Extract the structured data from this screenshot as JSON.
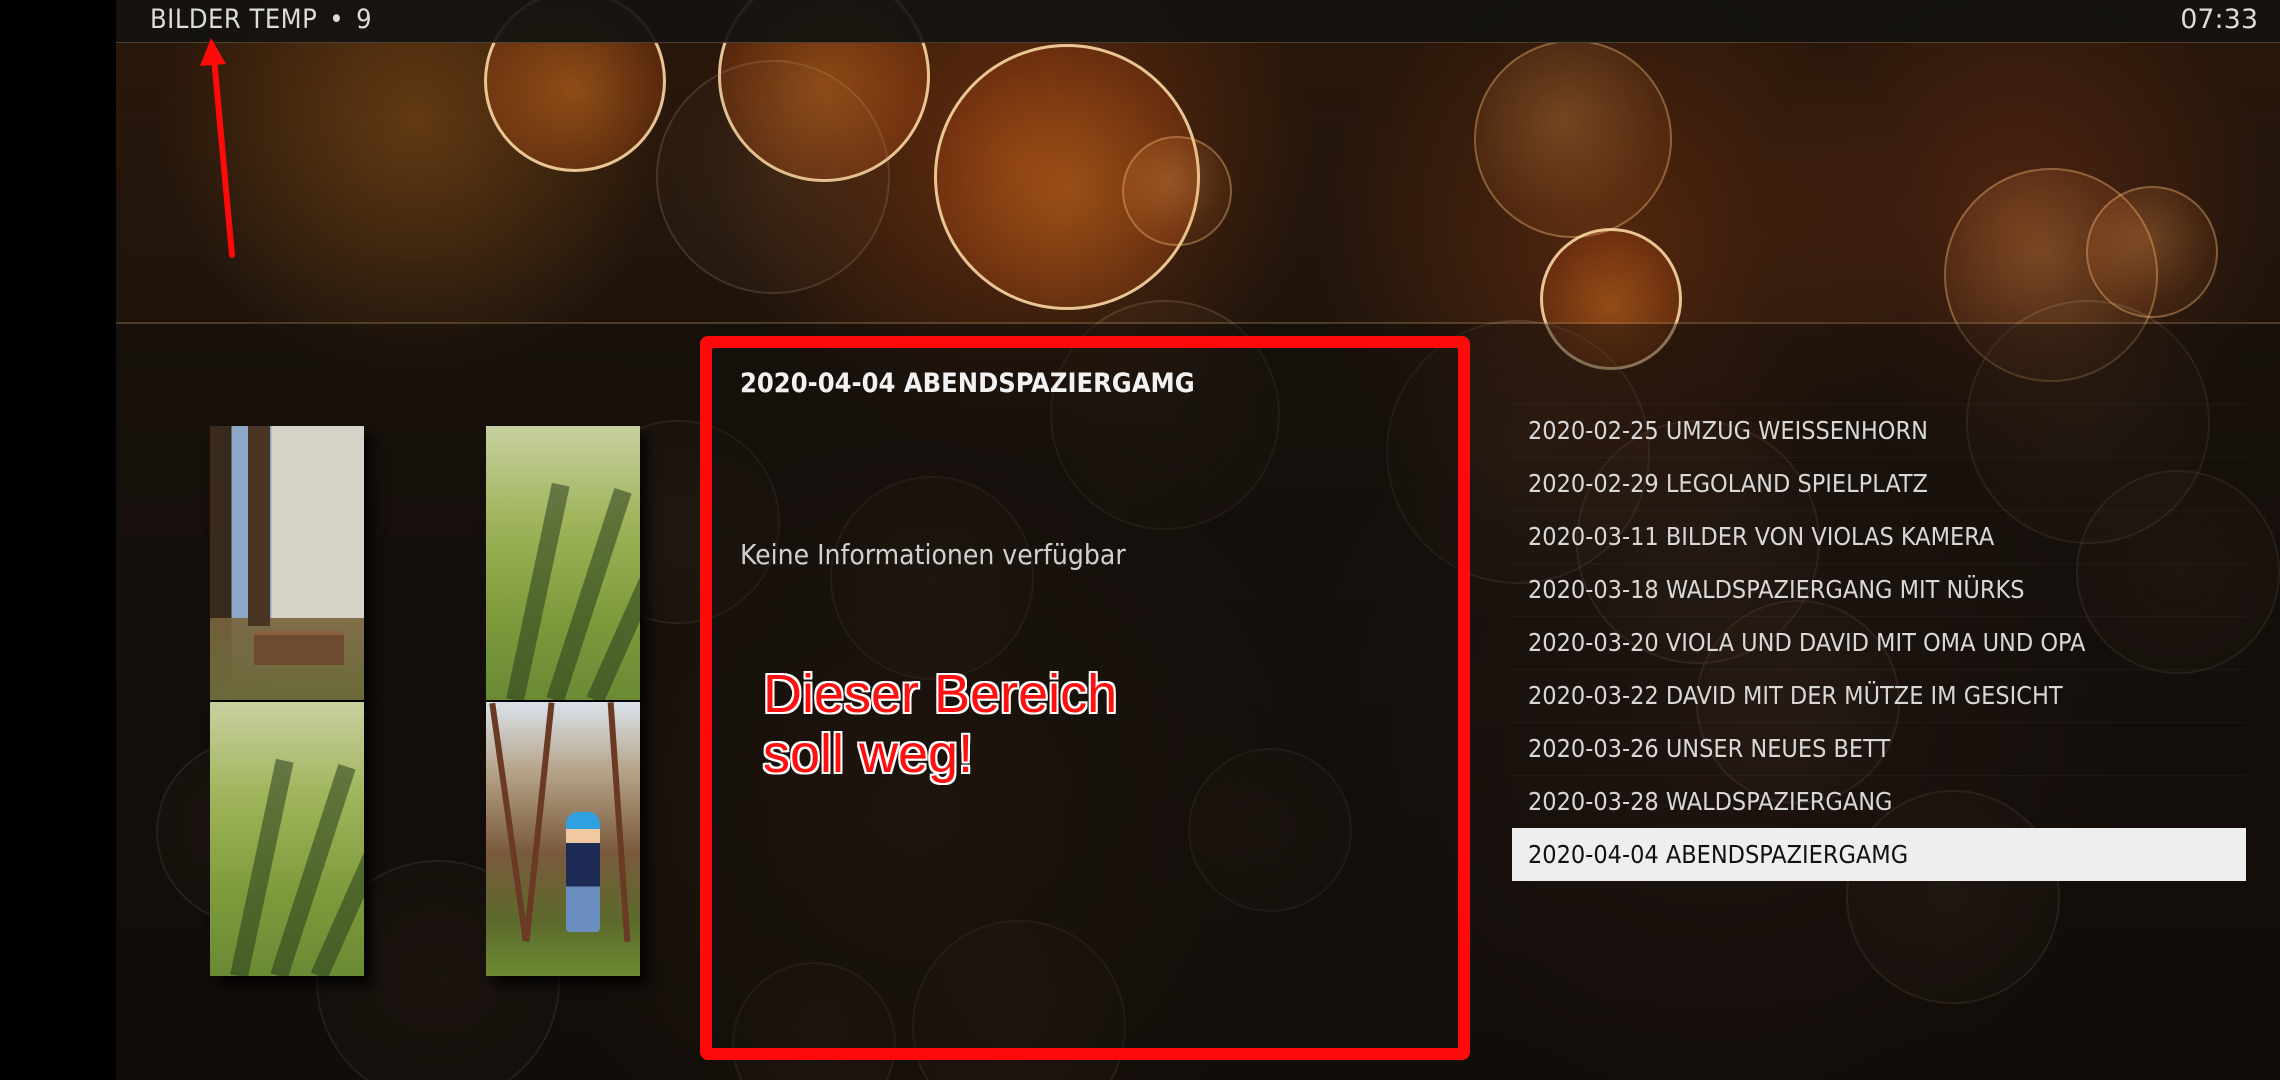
{
  "header": {
    "section": "BILDER TEMP",
    "separator": "•",
    "count": "9",
    "time": "07:33"
  },
  "info_panel": {
    "title": "2020-04-04 ABENDSPAZIERGAMG",
    "message": "Keine Informationen verfügbar"
  },
  "annotation": {
    "text": "Dieser Bereich\nsoll weg!",
    "color": "#ff0a0a"
  },
  "thumbnails": [
    {
      "icon": "photo-bench-thumbnail"
    },
    {
      "icon": "photo-lawn-shadows-thumbnail"
    },
    {
      "icon": "photo-lawn-shadows-thumbnail"
    },
    {
      "icon": "photo-forest-child-thumbnail"
    }
  ],
  "list": {
    "items": [
      {
        "label": "2020-02-25 UMZUG WEISSENHORN"
      },
      {
        "label": "2020-02-29 LEGOLAND SPIELPLATZ"
      },
      {
        "label": "2020-03-11 BILDER VON VIOLAS KAMERA"
      },
      {
        "label": "2020-03-18 WALDSPAZIERGANG MIT NÜRKS"
      },
      {
        "label": "2020-03-20 VIOLA UND DAVID MIT OMA UND OPA"
      },
      {
        "label": "2020-03-22 DAVID MIT DER MÜTZE IM GESICHT"
      },
      {
        "label": "2020-03-26 UNSER NEUES BETT"
      },
      {
        "label": "2020-03-28 WALDSPAZIERGANG"
      },
      {
        "label": "2020-04-04 ABENDSPAZIERGAMG"
      }
    ],
    "selected_index": 8
  },
  "colors": {
    "selection_background": "#eeeeee",
    "annotation_red": "#ff0a0a"
  }
}
